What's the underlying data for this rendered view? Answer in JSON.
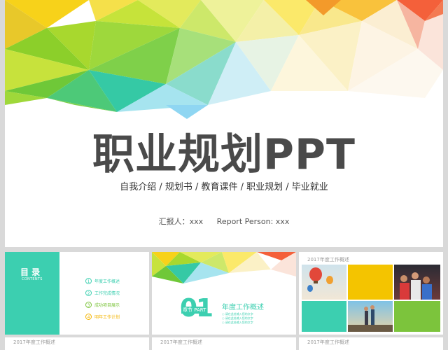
{
  "main_slide": {
    "title": "职业规划PPT",
    "subtitle": "自我介绍 / 规划书 / 教育课件 / 职业规划 / 毕业就业",
    "reporter_cn": "汇报人：xxx",
    "reporter_en": "Report Person: xxx"
  },
  "thumbs": {
    "toc": {
      "heading": "目 录",
      "heading_en": "CONTENTS",
      "items": [
        {
          "num": "1",
          "label": "年度工作概述",
          "color": "#3ccfb0"
        },
        {
          "num": "2",
          "label": "工作完成情况",
          "color": "#3ccfb0"
        },
        {
          "num": "3",
          "label": "成功项目展示",
          "color": "#7cc43c"
        },
        {
          "num": "4",
          "label": "明年工作计划",
          "color": "#f4b400"
        }
      ]
    },
    "section": {
      "number": "01",
      "chapter": "章节 PART",
      "title": "年度工作概述",
      "lines": [
        "○ 请在此处输入您的文字",
        "○ 请在此处输入您的文字",
        "○ 请在此处输入您的文字"
      ]
    },
    "overview": {
      "title": "2017年度工作概述"
    }
  },
  "bottom_row": {
    "labels": [
      "2017年度工作概述",
      "2017年度工作概述",
      "2017年度工作概述"
    ]
  },
  "colors": {
    "accent": "#3ccfb0",
    "title": "#4a4a4a",
    "green": "#7cc43c",
    "yellow": "#f4b400"
  }
}
